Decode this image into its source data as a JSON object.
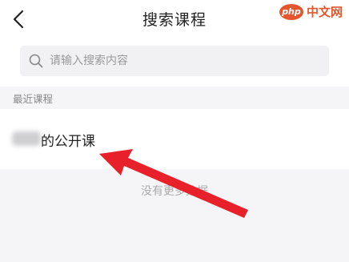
{
  "header": {
    "title": "搜索课程",
    "back_icon": "chevron-left-icon"
  },
  "watermark": {
    "logo": "php",
    "text": "中文网"
  },
  "search": {
    "placeholder": "请输入搜索内容",
    "icon": "search-icon"
  },
  "recent": {
    "label": "最近课程",
    "items": [
      {
        "title_suffix": "的公开课"
      }
    ]
  },
  "empty_state": {
    "text": "没有更多数据"
  },
  "colors": {
    "accent_red": "#e4572e",
    "arrow_red": "#e8202a",
    "background": "#f5f5f7"
  }
}
